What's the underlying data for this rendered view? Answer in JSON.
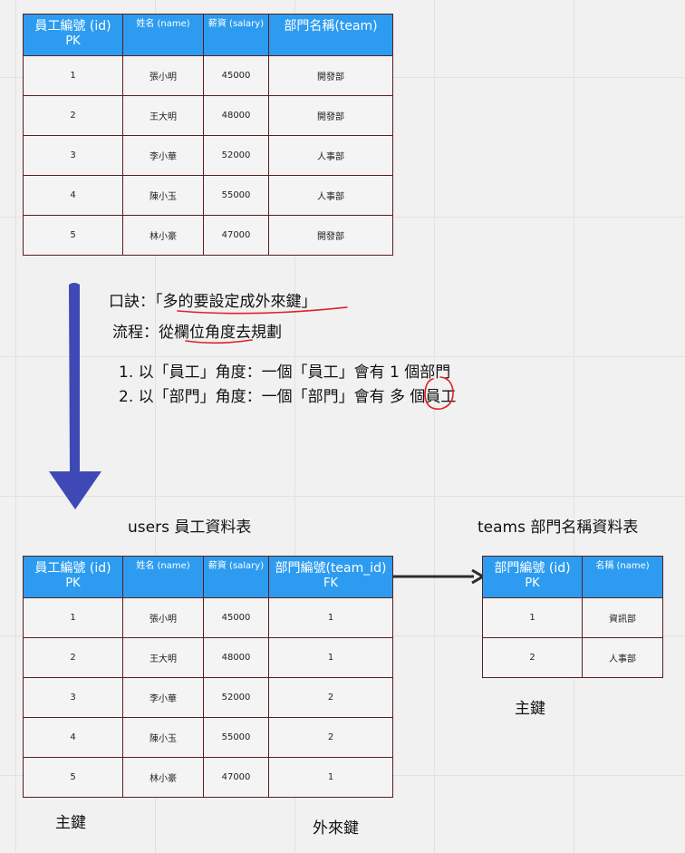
{
  "top_table": {
    "headers": {
      "id": "員工編號 (id)",
      "id_key": "PK",
      "name": "姓名 (name)",
      "salary": "薪資 (salary)",
      "team": "部門名稱(team)"
    },
    "rows": [
      {
        "id": "1",
        "name": "張小明",
        "salary": "45000",
        "team": "開發部"
      },
      {
        "id": "2",
        "name": "王大明",
        "salary": "48000",
        "team": "開發部"
      },
      {
        "id": "3",
        "name": "李小華",
        "salary": "52000",
        "team": "人事部"
      },
      {
        "id": "4",
        "name": "陳小玉",
        "salary": "55000",
        "team": "人事部"
      },
      {
        "id": "5",
        "name": "林小豪",
        "salary": "47000",
        "team": "開發部"
      }
    ]
  },
  "notes": {
    "mnemonic": "口訣：「多的要設定成外來鍵」",
    "process": "流程：從欄位角度去規劃",
    "step1": "1. 以「員工」角度：一個「員工」會有 1 個部門",
    "step2": "2. 以「部門」角度：一個「部門」會有 多 個員工"
  },
  "users_table": {
    "title": "users 員工資料表",
    "headers": {
      "id": "員工編號 (id)",
      "id_key": "PK",
      "name": "姓名 (name)",
      "salary": "薪資 (salary)",
      "team_id": "部門編號(team_id)",
      "team_id_key": "FK"
    },
    "rows": [
      {
        "id": "1",
        "name": "張小明",
        "salary": "45000",
        "team_id": "1"
      },
      {
        "id": "2",
        "name": "王大明",
        "salary": "48000",
        "team_id": "1"
      },
      {
        "id": "3",
        "name": "李小華",
        "salary": "52000",
        "team_id": "2"
      },
      {
        "id": "4",
        "name": "陳小玉",
        "salary": "55000",
        "team_id": "2"
      },
      {
        "id": "5",
        "name": "林小豪",
        "salary": "47000",
        "team_id": "1"
      }
    ],
    "primary_key_label": "主鍵",
    "foreign_key_label": "外來鍵"
  },
  "teams_table": {
    "title": "teams 部門名稱資料表",
    "headers": {
      "id": "部門編號 (id)",
      "id_key": "PK",
      "name": "名稱 (name)"
    },
    "rows": [
      {
        "id": "1",
        "name": "資訊部"
      },
      {
        "id": "2",
        "name": "人事部"
      }
    ],
    "primary_key_label": "主鍵"
  },
  "colors": {
    "header_blue": "#2d9cf0",
    "arrow_blue": "#3f49b5",
    "annotation_red": "#e0202a",
    "cell_border": "#5a1e1e"
  }
}
